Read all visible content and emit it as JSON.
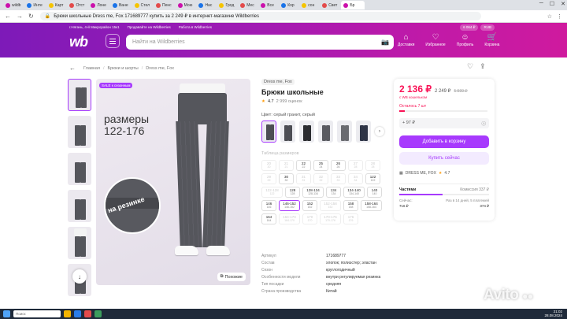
{
  "browser": {
    "tabs": [
      "wildb",
      "Инте",
      "Карт",
      "Отст",
      "Лоне",
      "Ване",
      "Стел",
      "Пенс",
      "Мою",
      "Нас",
      "Грод",
      "Мес",
      "Все",
      "Кор",
      "сон",
      "Свет",
      "Бр"
    ],
    "active_tab_index": 16,
    "url": "Брюки школьные Dress me, Fox 171689777 купить за 2 249 ₽ в интернет-магазине Wildberries"
  },
  "header": {
    "location": "г.Нягань, 4-й Микрорайон 15к1",
    "sell_link": "Продавайте на Wildberries",
    "work_link": "Работа в Wildberries",
    "currency": "RUB",
    "balance": "6 064 ₽",
    "logo": "wb",
    "search_placeholder": "Найти на Wildberries",
    "nav": [
      {
        "label": "Доставки",
        "icon": "delivery-icon"
      },
      {
        "label": "Избранное",
        "icon": "heart-icon"
      },
      {
        "label": "Профиль",
        "icon": "profile-icon"
      },
      {
        "label": "Корзина",
        "icon": "cart-icon"
      }
    ]
  },
  "breadcrumbs": [
    "Главная",
    "Брюки и шорты",
    "Dress me, Fox"
  ],
  "gallery": {
    "sale_badge": "SALE к сезонным",
    "promo_line1": "размеры",
    "promo_line2": "122-176",
    "circle_text": "на резинке",
    "similar_label": "Похожие"
  },
  "product": {
    "brand": "Dress me, Fox",
    "title": "Брюки школьные",
    "rating": "4.7",
    "reviews": "2 999 оценок",
    "color_label": "Цвет: серый гранит, серый",
    "size_table_label": "Таблица размеров",
    "sizes": [
      {
        "top": "20",
        "bottom": "20",
        "available": false
      },
      {
        "top": "21",
        "bottom": "21",
        "available": false
      },
      {
        "top": "22",
        "bottom": "22",
        "available": true
      },
      {
        "top": "25",
        "bottom": "24",
        "available": true
      },
      {
        "top": "26",
        "bottom": "26",
        "available": true
      },
      {
        "top": "27",
        "bottom": "28",
        "available": false
      },
      {
        "top": "28",
        "bottom": "28",
        "available": false
      },
      {
        "top": "29",
        "bottom": "29",
        "available": false
      },
      {
        "top": "30",
        "bottom": "30",
        "available": true
      },
      {
        "top": "31",
        "bottom": "31",
        "available": false
      },
      {
        "top": "32",
        "bottom": "32",
        "available": false
      },
      {
        "top": "33",
        "bottom": "33",
        "available": false
      },
      {
        "top": "34",
        "bottom": "34",
        "available": false
      },
      {
        "top": "122",
        "bottom": "122",
        "available": true
      },
      {
        "top": "122-128",
        "bottom": "122",
        "available": false
      },
      {
        "top": "128",
        "bottom": "128",
        "available": true
      },
      {
        "top": "128-134",
        "bottom": "128-134",
        "available": true
      },
      {
        "top": "134",
        "bottom": "134",
        "available": true
      },
      {
        "top": "134-140",
        "bottom": "134-140",
        "available": true
      },
      {
        "top": "140",
        "bottom": "140",
        "available": true
      },
      {
        "top": "146",
        "bottom": "146",
        "available": true
      },
      {
        "top": "146-152",
        "bottom": "146-152",
        "available": true,
        "selected": true
      },
      {
        "top": "152",
        "bottom": "152",
        "available": true
      },
      {
        "top": "152-158",
        "bottom": "152",
        "available": false
      },
      {
        "top": "158",
        "bottom": "158",
        "available": true
      },
      {
        "top": "158-164",
        "bottom": "158-164",
        "available": true
      },
      {
        "top": "164",
        "bottom": "164",
        "available": true
      },
      {
        "top": "164-170",
        "bottom": "164-170",
        "available": false
      },
      {
        "top": "170",
        "bottom": "170",
        "available": false
      },
      {
        "top": "170-176",
        "bottom": "170-176",
        "available": false
      },
      {
        "top": "176",
        "bottom": "176",
        "available": false
      }
    ],
    "specs": [
      {
        "k": "Артикул",
        "v": "171689777"
      },
      {
        "k": "Состав",
        "v": "хлопок; полиэстер; эластан"
      },
      {
        "k": "Сезон",
        "v": "круглогодичный"
      },
      {
        "k": "Особенности модели",
        "v": "внутри регулируемая резинка"
      },
      {
        "k": "Тип посадки",
        "v": "средняя"
      },
      {
        "k": "Страна производства",
        "v": "Китай"
      }
    ]
  },
  "price_card": {
    "price": "2 136 ₽",
    "price_before": "2 249 ₽",
    "price_old": "5 599 ₽",
    "wallet_note": "с WB кошельком",
    "stock_left": "Осталось 7 шт",
    "stock_fraction": 0.06,
    "points": "+ 97 ₽",
    "add_to_cart": "Добавить в корзину",
    "buy_now": "Купить сейчас",
    "seller": "DRESS ME, FOX",
    "seller_rating": "4.7",
    "parts_label": "Частями",
    "commission": "Комиссия 337 ₽",
    "now_label": "Сейчас:",
    "now_value": "716 ₽",
    "later_label": "Раз в 14 дней, 5 платежей",
    "later_value": "374 ₽"
  },
  "taskbar": {
    "search_placeholder": "Поиск",
    "time": "21:02",
    "date": "28.08.2024"
  },
  "watermark": "Avito"
}
